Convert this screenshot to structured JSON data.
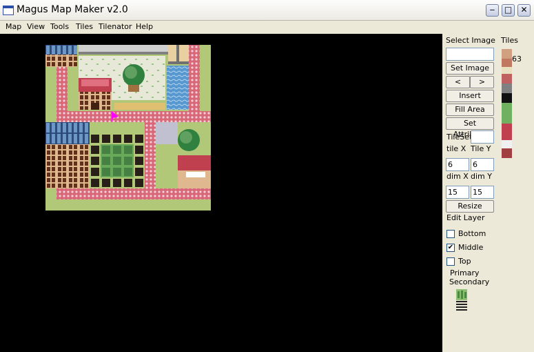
{
  "window": {
    "title": "Magus Map Maker v2.0"
  },
  "menu": {
    "items": [
      "Map",
      "View",
      "Tools",
      "Tiles",
      "Tilenator",
      "Help"
    ]
  },
  "panel": {
    "select_image_label": "Select Image",
    "tiles_label": "Tiles",
    "tile_count": "63",
    "set_image": "Set Image",
    "prev": "<",
    "next": ">",
    "insert_image": "Insert Image",
    "fill_area": "Fill Area",
    "set_attribute": "Set Attribute",
    "tileset_label": "TileSet",
    "tile_x_label": "tile X",
    "tile_y_label": "Tile Y",
    "tile_x": "6",
    "tile_y": "6",
    "dim_x_label": "dim X",
    "dim_y_label": "dim Y",
    "dim_x": "15",
    "dim_y": "15",
    "resize": "Resize",
    "edit_layer_label": "Edit Layer",
    "bottom_label": "Bottom",
    "middle_label": "Middle",
    "top_label": "Top",
    "bottom_checked": false,
    "middle_checked": true,
    "top_checked": false,
    "primary_label": "Primary",
    "secondary_label": "Secondary"
  },
  "colors": {
    "canvas": "#000000",
    "grass": "#b0c878",
    "path": "#d07080",
    "roof_blue": "#4878a8",
    "house_red": "#c04050",
    "water": "#58a0d8",
    "cursor": "#ff00ff"
  }
}
